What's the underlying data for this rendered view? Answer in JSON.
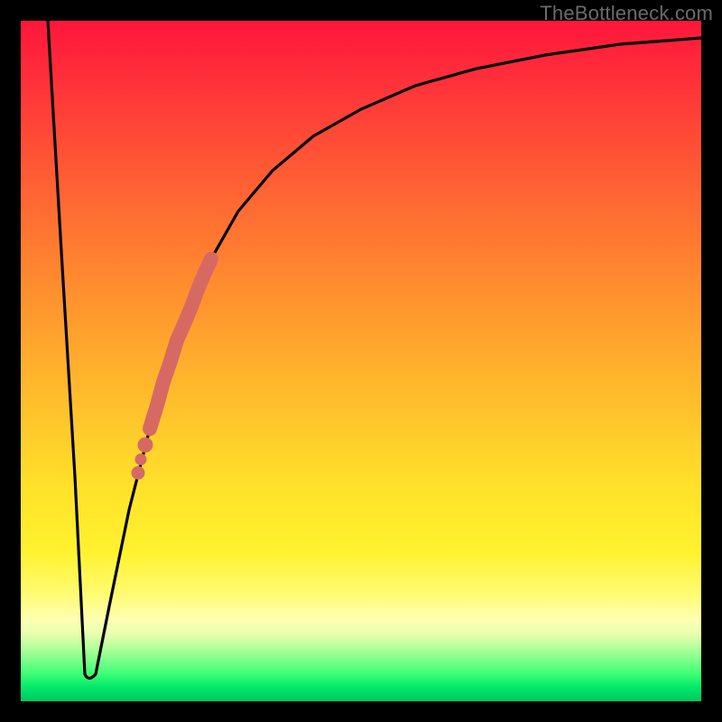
{
  "watermark": "TheBottleneck.com",
  "colors": {
    "frame": "#000000",
    "curve": "#000000",
    "highlight": "#d66a63",
    "gradient_stops": [
      "#ff163b",
      "#ff5a34",
      "#ffb92c",
      "#fff22e",
      "#ffffb2",
      "#00e86a",
      "#00c85f"
    ]
  },
  "chart_data": {
    "type": "line",
    "title": "",
    "xlabel": "",
    "ylabel": "",
    "xlim": [
      0,
      100
    ],
    "ylim": [
      0,
      100
    ],
    "grid": false,
    "legend": false,
    "note": "Axes are unlabeled in the source image; x/y values are pixel-fraction estimates (0–100) read from the figure geometry.",
    "series": [
      {
        "name": "bottleneck-curve",
        "x": [
          4,
          6,
          8,
          9.5,
          11,
          13,
          16,
          19,
          22,
          25,
          28,
          32,
          37,
          43,
          50,
          58,
          67,
          77,
          88,
          100
        ],
        "y": [
          100,
          66,
          33,
          4,
          4,
          14,
          28,
          40,
          50,
          58,
          65,
          72,
          78,
          83,
          87,
          90.5,
          93,
          95,
          96.5,
          97.5
        ]
      }
    ],
    "highlight_segment": {
      "description": "thick salmon overlay on rising limb",
      "x": [
        19,
        20,
        21,
        22,
        23,
        24,
        25,
        26,
        27,
        28
      ],
      "y": [
        40,
        43.5,
        47,
        50,
        53,
        55.5,
        58,
        60.5,
        63,
        65
      ]
    },
    "highlight_dots": {
      "description": "three salmon dots just below the thick segment",
      "points": [
        {
          "x": 17.2,
          "y": 33.5
        },
        {
          "x": 17.7,
          "y": 35.5
        },
        {
          "x": 18.3,
          "y": 37.7
        }
      ]
    }
  }
}
